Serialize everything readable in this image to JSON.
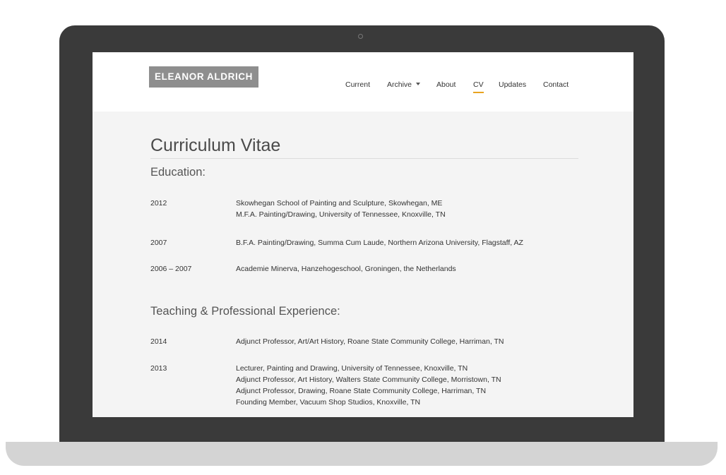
{
  "site": {
    "logo": "ELEANOR ALDRICH"
  },
  "nav": {
    "items": [
      {
        "label": "Current",
        "active": false
      },
      {
        "label": "Archive",
        "active": false,
        "has_dropdown": true
      },
      {
        "label": "About",
        "active": false
      },
      {
        "label": "CV",
        "active": true
      },
      {
        "label": "Updates",
        "active": false
      },
      {
        "label": "Contact",
        "active": false
      }
    ],
    "active_underline_color": "#e8a320"
  },
  "page": {
    "title": "Curriculum Vitae"
  },
  "sections": [
    {
      "heading": "Education:",
      "entries": [
        {
          "year": "2012",
          "lines": [
            "Skowhegan School of Painting and Sculpture, Skowhegan, ME",
            "M.F.A. Painting/Drawing, University of Tennessee, Knoxville, TN"
          ]
        },
        {
          "year": "2007",
          "lines": [
            "B.F.A. Painting/Drawing, Summa Cum Laude, Northern Arizona University, Flagstaff, AZ"
          ]
        },
        {
          "year": "2006 – 2007",
          "lines": [
            "Academie Minerva, Hanzehogeschool, Groningen, the Netherlands"
          ]
        }
      ]
    },
    {
      "heading": "Teaching & Professional Experience:",
      "entries": [
        {
          "year": "2014",
          "lines": [
            "Adjunct Professor, Art/Art History, Roane State Community College, Harriman, TN"
          ]
        },
        {
          "year": "2013",
          "lines": [
            "Lecturer, Painting and Drawing, University of Tennessee, Knoxville, TN",
            "Adjunct Professor, Art History, Walters State Community College, Morristown, TN",
            "Adjunct Professor, Drawing, Roane State Community College, Harriman, TN",
            "Founding Member, Vacuum Shop Studios, Knoxville, TN"
          ]
        }
      ]
    }
  ],
  "colors": {
    "laptop_frame": "#3a3a3a",
    "laptop_base": "#d4d4d4",
    "page_background": "#f4f4f4",
    "header_background": "#ffffff",
    "logo_background": "#8e8e8e"
  }
}
